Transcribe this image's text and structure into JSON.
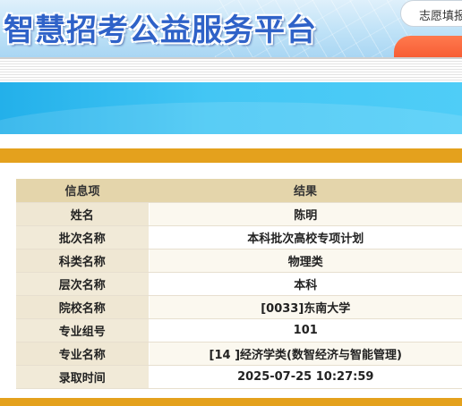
{
  "header": {
    "site_title": "智慧招考公益服务平台",
    "user_menu_label": "志愿填报"
  },
  "result_table": {
    "col_header_item": "信息项",
    "col_header_result": "结果",
    "rows": [
      {
        "label": "姓名",
        "value": "陈明"
      },
      {
        "label": "批次名称",
        "value": "本科批次高校专项计划"
      },
      {
        "label": "科类名称",
        "value": "物理类"
      },
      {
        "label": "层次名称",
        "value": "本科"
      },
      {
        "label": "院校名称",
        "value": "[0033]东南大学"
      },
      {
        "label": "专业组号",
        "value": "101"
      },
      {
        "label": "专业名称",
        "value": "[14 ]经济学类(数智经济与智能管理)"
      },
      {
        "label": "录取时间",
        "value": "2025-07-25 10:27:59"
      }
    ]
  },
  "colors": {
    "title_blue": "#2f62c8",
    "banner_blue": "#3bbff0",
    "gold_bar": "#e4a11d",
    "table_header": "#e4d5ab",
    "orange_tab": "#f4522a"
  }
}
